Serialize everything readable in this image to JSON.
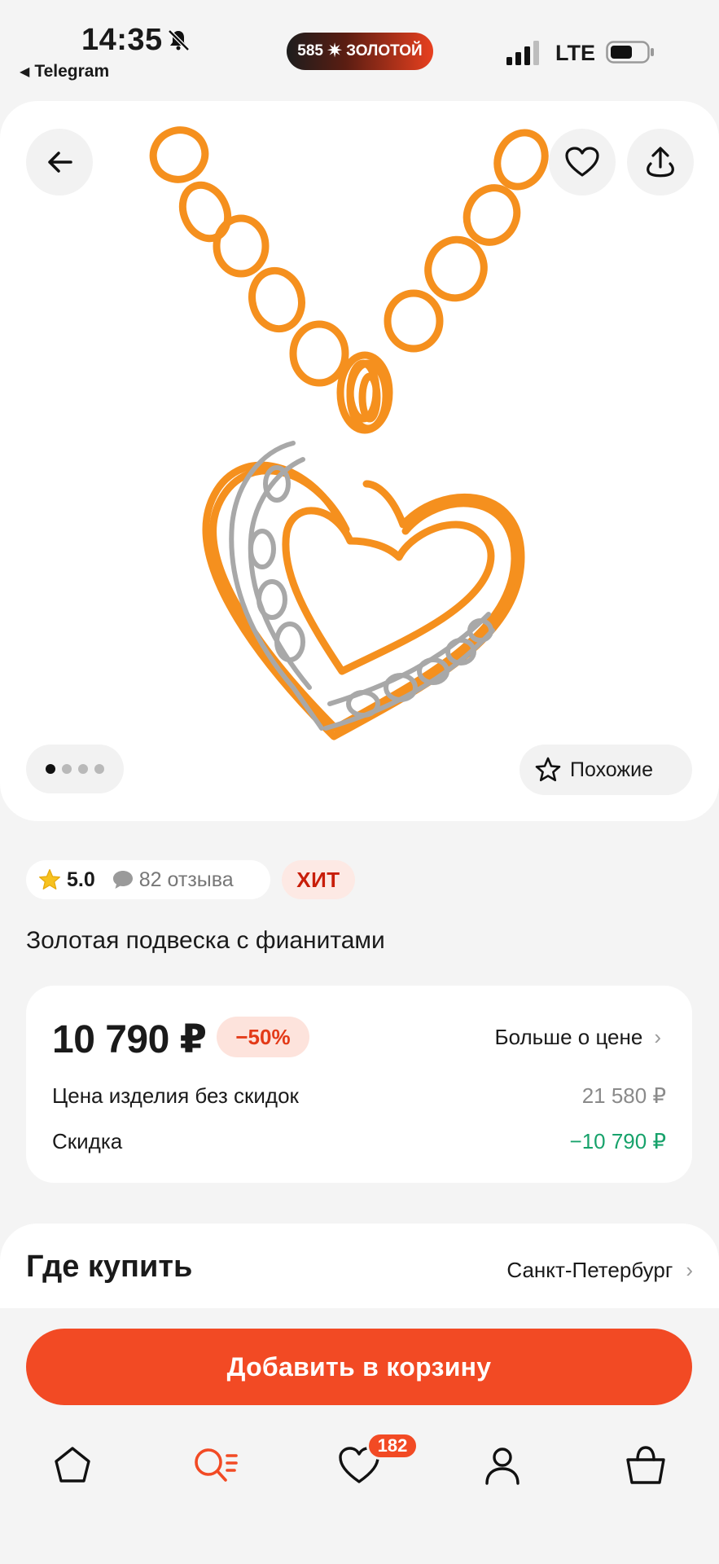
{
  "status_bar": {
    "time": "14:35",
    "back_app": "Telegram",
    "promo_left": "585",
    "promo_right": "ЗОЛОТОЙ",
    "network": "LTE"
  },
  "hero": {
    "pager_count": 4,
    "pager_active": 1,
    "similar_label": "Похожие"
  },
  "rating": {
    "score": "5.0",
    "reviews": "82 отзыва",
    "hit": "ХИТ"
  },
  "product": {
    "title": "Золотая подвеска с фианитами"
  },
  "price": {
    "current": "10 790 ₽",
    "discount_badge": "−50%",
    "more_label": "Больше о цене",
    "orig_label": "Цена изделия без скидок",
    "orig_value": "21 580 ₽",
    "discount_label": "Скидка",
    "discount_value": "−10 790 ₽"
  },
  "where": {
    "title": "Где купить",
    "city": "Санкт-Петербург"
  },
  "cta": {
    "add_to_cart": "Добавить в корзину"
  },
  "tabbar": {
    "favorites_badge": "182",
    "items": [
      "home-icon",
      "catalog-search-icon",
      "favorites-icon",
      "profile-icon",
      "cart-icon"
    ]
  },
  "colors": {
    "accent": "#f24a24",
    "gold_drawing": "#f5901e",
    "silver_drawing": "#a8a8a8",
    "discount_green": "#17a26b",
    "hit_red": "#c81e0a"
  }
}
